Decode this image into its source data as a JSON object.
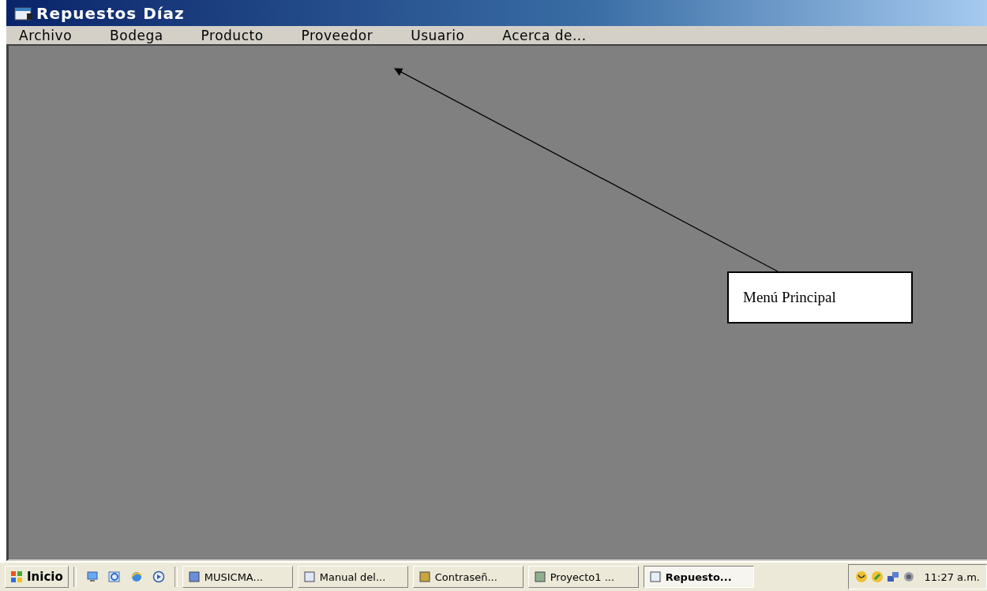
{
  "window": {
    "title": "Repuestos Díaz"
  },
  "menu": [
    {
      "label": "Archivo"
    },
    {
      "label": "Bodega"
    },
    {
      "label": "Producto"
    },
    {
      "label": "Proveedor"
    },
    {
      "label": "Usuario"
    },
    {
      "label": "Acerca de..."
    }
  ],
  "annotation": {
    "text": "Menú Principal"
  },
  "taskbar": {
    "start": "Inicio",
    "tasks": [
      {
        "label": "MUSICMA...",
        "selected": false
      },
      {
        "label": "Manual del...",
        "selected": false
      },
      {
        "label": "Contraseñ...",
        "selected": false
      },
      {
        "label": "Proyecto1 ...",
        "selected": false
      },
      {
        "label": "Repuesto...",
        "selected": true
      }
    ],
    "clock": "11:27 a.m."
  }
}
